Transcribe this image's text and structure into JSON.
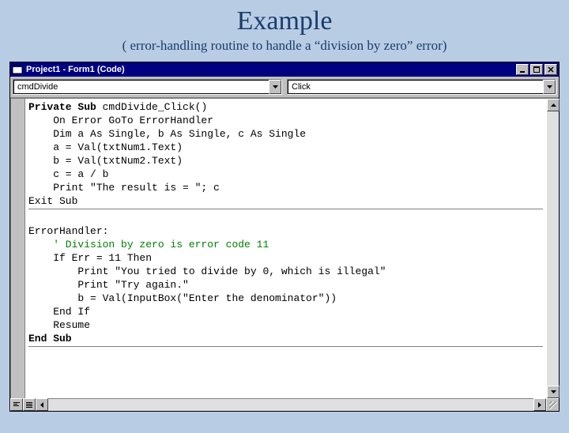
{
  "slide": {
    "title": "Example",
    "subtitle": "( error-handling routine to handle a “division by zero” error)"
  },
  "window": {
    "title": "Project1 - Form1 (Code)"
  },
  "dropdowns": {
    "object": "cmdDivide",
    "procedure": "Click"
  },
  "code": {
    "l1a": "Private Sub",
    "l1b": " cmdDivide_Click()",
    "l2": "    On Error GoTo ErrorHandler",
    "l3": "    Dim a As Single, b As Single, c As Single",
    "l4": "    a = Val(txtNum1.Text)",
    "l5": "    b = Val(txtNum2.Text)",
    "l6": "    c = a / b",
    "l7": "    Print \"The result is = \"; c",
    "l8": "Exit Sub",
    "l10": "ErrorHandler:",
    "l11": "    ' Division by zero is error code 11",
    "l12": "    If Err = 11 Then",
    "l13": "        Print \"You tried to divide by 0, which is illegal\"",
    "l14": "        Print \"Try again.\"",
    "l15": "        b = Val(InputBox(\"Enter the denominator\"))",
    "l16": "    End If",
    "l17": "    Resume",
    "l18a": "End Sub"
  }
}
